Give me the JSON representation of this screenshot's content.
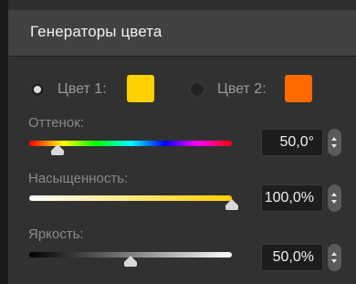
{
  "panel": {
    "title": "Генераторы цвета"
  },
  "colors": {
    "options": [
      {
        "label": "Цвет 1:",
        "swatch": "#ffd000",
        "selected": true
      },
      {
        "label": "Цвет 2:",
        "swatch": "#ff6a00",
        "selected": false
      }
    ]
  },
  "sliders": {
    "hue": {
      "label": "Оттенок:",
      "value": "50,0°",
      "position": 0.14
    },
    "saturation": {
      "label": "Насыщенность:",
      "value": "100,0%",
      "position": 1.0
    },
    "brightness": {
      "label": "Яркость:",
      "value": "50,0%",
      "position": 0.5
    }
  }
}
